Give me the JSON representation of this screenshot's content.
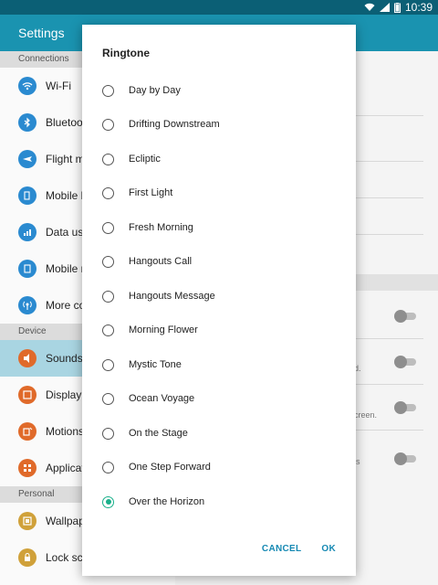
{
  "status_bar": {
    "time": "10:39"
  },
  "app_bar": {
    "title": "Settings"
  },
  "left_sections": [
    {
      "header": "Connections",
      "items": [
        {
          "label": "Wi-Fi",
          "icon": "wifi-icon"
        },
        {
          "label": "Bluetoot",
          "icon": "bluetooth-icon"
        },
        {
          "label": "Flight m",
          "icon": "airplane-icon"
        },
        {
          "label": "Mobile h",
          "icon": "hotspot-icon"
        },
        {
          "label": "Data usa",
          "icon": "data-usage-icon"
        },
        {
          "label": "Mobile n",
          "icon": "mobile-networks-icon"
        },
        {
          "label": "More co",
          "icon": "more-connections-icon"
        }
      ]
    },
    {
      "header": "Device",
      "items": [
        {
          "label": "Sounds",
          "icon": "sound-icon"
        },
        {
          "label": "Display",
          "icon": "display-icon"
        },
        {
          "label": "Motions",
          "icon": "motions-icon"
        },
        {
          "label": "Applicat",
          "icon": "applications-icon"
        }
      ]
    },
    {
      "header": "Personal",
      "items": [
        {
          "label": "Wallpap",
          "icon": "wallpaper-icon"
        },
        {
          "label": "Lock scr",
          "icon": "lock-icon"
        }
      ]
    }
  ],
  "right_pane": {
    "peek_text_1": "d.",
    "peek_text_2": "creen.",
    "peek_text_3": "is"
  },
  "dialog": {
    "title": "Ringtone",
    "options": [
      "Day by Day",
      "Drifting Downstream",
      "Ecliptic",
      "First Light",
      "Fresh Morning",
      "Hangouts Call",
      "Hangouts Message",
      "Morning Flower",
      "Mystic Tone",
      "Ocean Voyage",
      "On the Stage",
      "One Step Forward",
      "Over the Horizon"
    ],
    "selected_option": "Over the Horizon",
    "cancel_label": "CANCEL",
    "ok_label": "OK"
  },
  "colors": {
    "status_bar": "#0b5f75",
    "app_bar": "#1a93b0",
    "accent": "#19b08a",
    "button_text": "#1689b3",
    "active_item": "#a9d5e2"
  }
}
